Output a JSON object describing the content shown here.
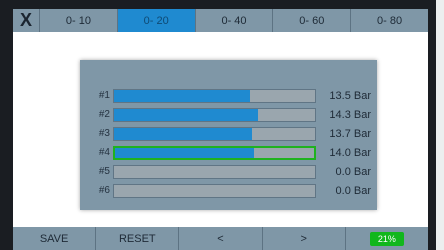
{
  "tabs": {
    "close": "X",
    "items": [
      {
        "label": "0- 10",
        "active": false
      },
      {
        "label": "0- 20",
        "active": true
      },
      {
        "label": "0- 40",
        "active": false
      },
      {
        "label": "0- 60",
        "active": false
      },
      {
        "label": "0- 80",
        "active": false
      }
    ]
  },
  "panel": {
    "max": 20,
    "channels": [
      {
        "label": "#1",
        "value": 13.5,
        "display": "13.5 Bar",
        "selected": false
      },
      {
        "label": "#2",
        "value": 14.3,
        "display": "14.3 Bar",
        "selected": false
      },
      {
        "label": "#3",
        "value": 13.7,
        "display": "13.7 Bar",
        "selected": false
      },
      {
        "label": "#4",
        "value": 14.0,
        "display": "14.0 Bar",
        "selected": true
      },
      {
        "label": "#5",
        "value": 0.0,
        "display": "0.0 Bar",
        "selected": false
      },
      {
        "label": "#6",
        "value": 0.0,
        "display": "0.0 Bar",
        "selected": false
      }
    ]
  },
  "bottom": {
    "save_label": "SAVE",
    "reset_label": "RESET",
    "prev_label": "<",
    "next_label": ">",
    "battery": "21%"
  },
  "colors": {
    "active_tab": "#1f8ad0",
    "bar_fill": "#1f8ad0",
    "selection": "#1fb21f",
    "battery": "#11b71c"
  }
}
